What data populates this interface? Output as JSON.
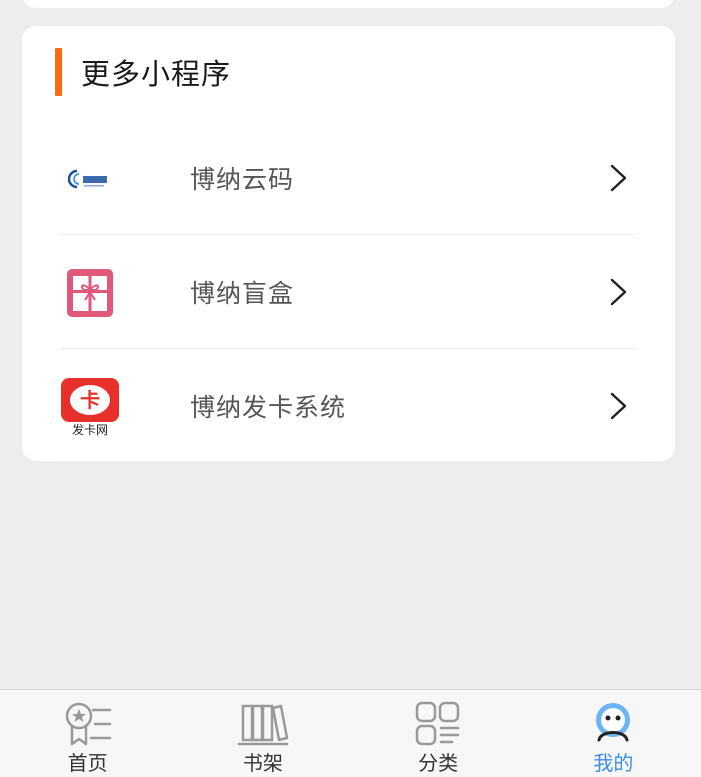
{
  "section": {
    "title": "更多小程序"
  },
  "items": [
    {
      "label": "博纳云码",
      "icon": "yunma-logo-icon"
    },
    {
      "label": "博纳盲盒",
      "icon": "gift-box-icon"
    },
    {
      "label": "博纳发卡系统",
      "icon": "fakawang-logo-icon",
      "logo_main": "卡",
      "logo_sub": "发卡网"
    }
  ],
  "tabs": [
    {
      "label": "首页",
      "icon": "home-award-icon",
      "active": false
    },
    {
      "label": "书架",
      "icon": "bookshelf-icon",
      "active": false
    },
    {
      "label": "分类",
      "icon": "category-grid-icon",
      "active": false
    },
    {
      "label": "我的",
      "icon": "profile-face-icon",
      "active": true
    }
  ],
  "colors": {
    "accent": "#ff6a13",
    "active_tab": "#3b8de8",
    "background": "#ededed"
  }
}
